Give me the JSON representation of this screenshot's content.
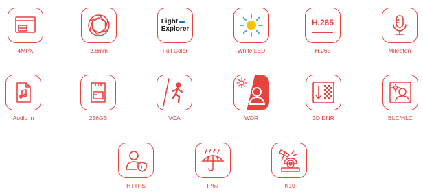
{
  "features": [
    {
      "label": "4MPX",
      "icon": "resolution-icon"
    },
    {
      "label": "2.8mm",
      "icon": "aperture-icon"
    },
    {
      "label": "Full Color",
      "icon": "light-explorer-icon",
      "logo_text": [
        "Light",
        "Explorer"
      ]
    },
    {
      "label": "White LED",
      "icon": "sun-icon"
    },
    {
      "label": "H.265",
      "icon": "h265-icon",
      "icon_text": "H.265"
    },
    {
      "label": "Mikrofon",
      "icon": "microphone-icon"
    },
    {
      "label": "Audio in",
      "icon": "audio-file-icon"
    },
    {
      "label": "256GB",
      "icon": "sd-card-icon"
    },
    {
      "label": "VCA",
      "icon": "intrusion-icon"
    },
    {
      "label": "WDR",
      "icon": "wdr-icon"
    },
    {
      "label": "3D DNR",
      "icon": "noise-reduction-icon"
    },
    {
      "label": "BLC/HLC",
      "icon": "backlight-icon"
    },
    {
      "label": "HTTPS",
      "icon": "secure-user-icon"
    },
    {
      "label": "IP67",
      "icon": "umbrella-rain-icon"
    },
    {
      "label": "IK10",
      "icon": "vandal-hammer-icon"
    }
  ],
  "colors": {
    "accent": "#e8423f",
    "text": "#e03a35",
    "logo_blue": "#1e73be"
  }
}
